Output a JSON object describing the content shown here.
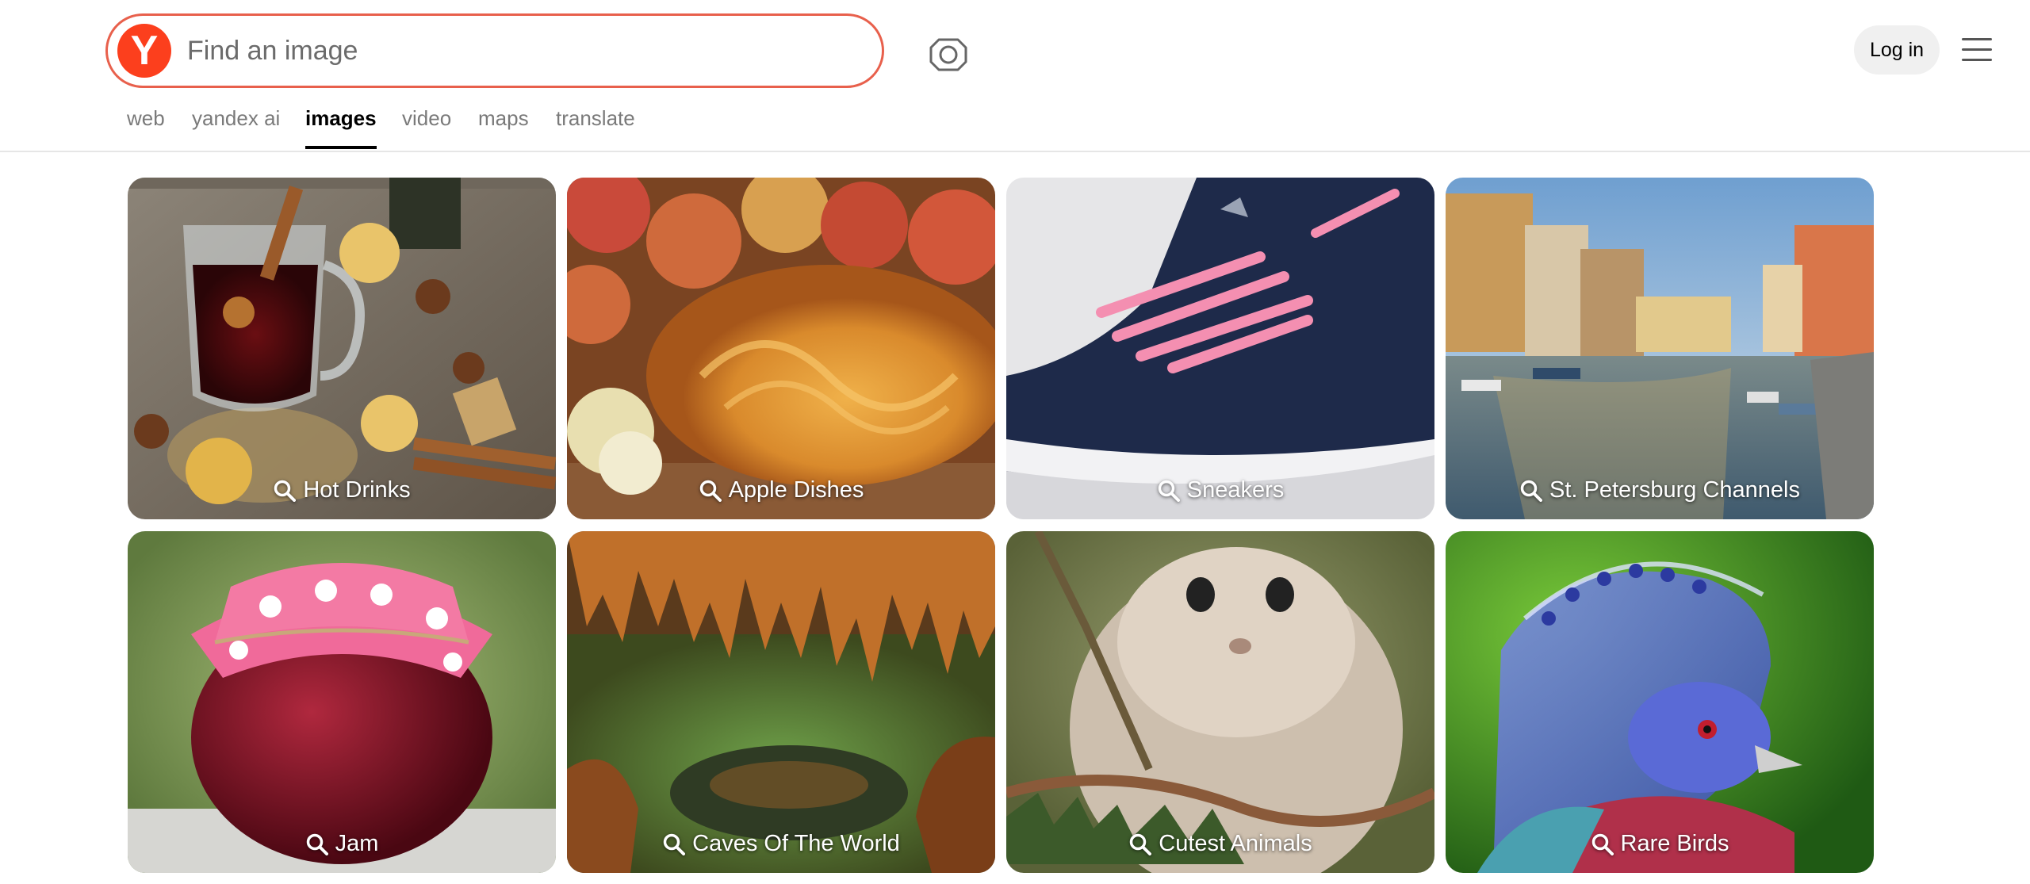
{
  "header": {
    "logo_letter": "Y",
    "search_placeholder": "Find an image",
    "login_label": "Log in",
    "icons": {
      "camera": "camera-search-icon",
      "menu": "hamburger-menu-icon"
    }
  },
  "tabs": [
    {
      "label": "web",
      "active": false
    },
    {
      "label": "yandex ai",
      "active": false
    },
    {
      "label": "images",
      "active": true
    },
    {
      "label": "video",
      "active": false
    },
    {
      "label": "maps",
      "active": false
    },
    {
      "label": "translate",
      "active": false
    }
  ],
  "tiles": [
    {
      "label": "Hot Drinks"
    },
    {
      "label": "Apple Dishes"
    },
    {
      "label": "Sneakers"
    },
    {
      "label": "St. Petersburg Channels"
    },
    {
      "label": "Jam"
    },
    {
      "label": "Caves Of The World"
    },
    {
      "label": "Cutest Animals"
    },
    {
      "label": "Rare Birds"
    }
  ],
  "colors": {
    "brand": "#fc3f1d",
    "search_border": "#e8604c",
    "active_tab": "#000000"
  }
}
